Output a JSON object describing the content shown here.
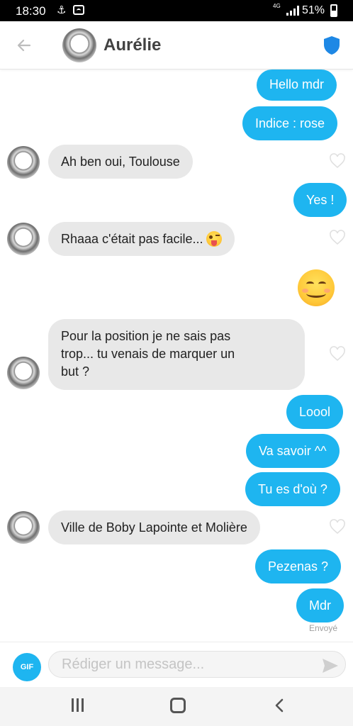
{
  "status_bar": {
    "time": "18:30",
    "network": "4G",
    "battery": "51%"
  },
  "header": {
    "contact_name": "Aurélie"
  },
  "messages": [
    {
      "text": "Hello mdr"
    },
    {
      "text": "Indice : rose"
    },
    {
      "text": "Ah ben oui, Toulouse"
    },
    {
      "text": "Yes !"
    },
    {
      "text": "Rhaaa c'était pas facile..."
    },
    {
      "text": "Pour la position je ne sais pas",
      "line2": "trop...  tu venais de marquer un",
      "line3": "but ?"
    },
    {
      "text": "Loool"
    },
    {
      "text": "Va savoir ^^"
    },
    {
      "text": "Tu es d'où ?"
    },
    {
      "text": "Ville de Boby Lapointe et Molière"
    },
    {
      "text": "Pezenas ?"
    },
    {
      "text": "Mdr"
    }
  ],
  "sent_status": "Envoyé",
  "composer": {
    "gif_label": "GIF",
    "placeholder": "Rédiger un message..."
  },
  "colors": {
    "outgoing_bubble": "#1eb5f0",
    "incoming_bubble": "#e8e8e8",
    "shield": "#1e88e5"
  },
  "icons": [
    "back-arrow-icon",
    "shield-icon",
    "heart-icon",
    "send-icon",
    "recents-icon",
    "home-icon",
    "nav-back-icon"
  ]
}
